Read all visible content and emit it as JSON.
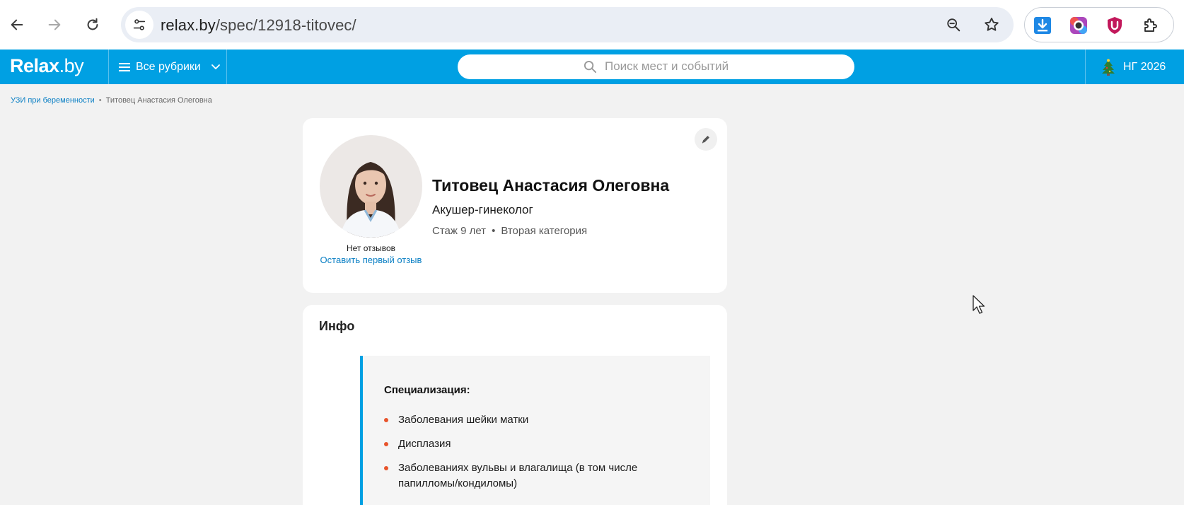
{
  "browser": {
    "url_host": "relax.by",
    "url_path": "/spec/12918-titovec/",
    "icons": [
      "back-arrow-icon",
      "forward-arrow-icon",
      "reload-icon",
      "site-info-icon",
      "zoom-icon",
      "bookmark-star-icon",
      "download-icon",
      "screenshot-ext-icon",
      "ublock-icon",
      "extensions-puzzle-icon"
    ]
  },
  "header": {
    "logo_main": "Relax",
    "logo_dot": ".by",
    "rubrics_label": "Все рубрики",
    "search_placeholder": "Поиск мест и событий",
    "ng_label": "НГ 2026",
    "accent_color": "#00a0e3"
  },
  "breadcrumb": {
    "parent": "УЗИ при беременности",
    "separator": "•",
    "current": "Титовец Анастасия Олеговна"
  },
  "profile": {
    "name": "Титовец Анастасия Олеговна",
    "specialty": "Акушер-гинеколог",
    "experience": "Стаж 9 лет",
    "meta_separator": "•",
    "category": "Вторая категория",
    "reviews_none": "Нет отзывов",
    "leave_review": "Оставить первый отзыв"
  },
  "info": {
    "title": "Инфо",
    "section_heading": "Специализация:",
    "items": [
      "Заболевания шейки матки",
      "Дисплазия",
      "Заболеваниях вульвы и влагалища (в том числе папилломы/кондиломы)"
    ]
  }
}
